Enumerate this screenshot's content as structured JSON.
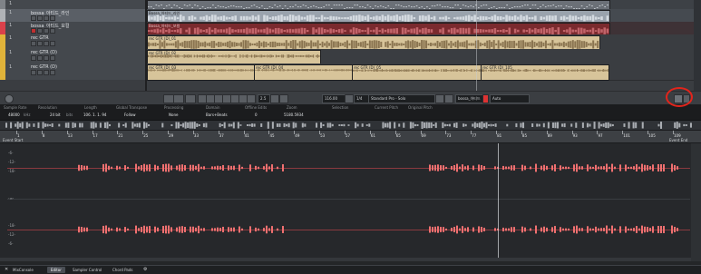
{
  "colors": {
    "accent": "#e3241b",
    "waveform": "#f07070",
    "clip_gold": "#d7c49a",
    "clip_red": "#8a2f2f",
    "clip_gray": "#9aa3ad"
  },
  "tracks": [
    {
      "num": "1",
      "name": "",
      "color": "#7f8388"
    },
    {
      "num": "1",
      "name": "bossa_아티드_라인",
      "color": "#b0b3b7"
    },
    {
      "num": "1",
      "name": "bossa_아티드_보컬",
      "color": "#d9404a"
    },
    {
      "num": "1",
      "name": "rec GTR",
      "color": "#e0b33a"
    },
    {
      "num": "1",
      "name": "rec GTR (D)",
      "color": "#e0b33a"
    },
    {
      "num": "1",
      "name": "rec GTR (D)",
      "color": "#e0b33a"
    }
  ],
  "clips": {
    "bossa_line": "Bossa_아티드_라인",
    "bossa_vocal": "Bossa_아티드_보컬",
    "rec1": "rec GTR (D)_01",
    "rec2": "rec GTR (D)_02",
    "rec3": "rec GTR (D)_03",
    "rec4": "rec GTR (D)_04",
    "rec5": "rec GTR (D)_05",
    "rec6": "rec GTR (D)_105"
  },
  "toolbar": {
    "field_zoom": "2.5",
    "field_pitch": "116.00",
    "field_snap": "1/4",
    "field_algo": "Standard Pro - Solo",
    "field_preset": "bossa_아티드",
    "field_auto": "Auto"
  },
  "info": {
    "headers": [
      "Sample Rate",
      "Resolution",
      "Length",
      "Global Transpose",
      "Processing",
      "Domain",
      "Offline Edits",
      "Zoom",
      "Selection",
      "Current Pitch",
      "Original Pitch"
    ],
    "values": [
      "48000",
      "24 bit",
      "106. 1. 1. 94",
      "Follow",
      "None",
      "Bars+Beats",
      "0",
      "5180.5934",
      "",
      "",
      ""
    ],
    "units": [
      "kHz",
      "bits"
    ]
  },
  "ruler": {
    "labels": [
      "1",
      "8",
      "13",
      "17",
      "21",
      "25",
      "29",
      "33",
      "37",
      "41",
      "45",
      "49",
      "53",
      "57",
      "61",
      "65",
      "69",
      "73",
      "77",
      "81",
      "85",
      "89",
      "93",
      "97",
      "101",
      "105",
      "109"
    ],
    "event_start": "Event Start",
    "event_end": "Event End"
  },
  "amp_labels": [
    "-6-",
    "-12-",
    "-18-",
    "-∞-",
    "-18-",
    "-12-",
    "-6-"
  ],
  "tabs": [
    "MixConsole",
    "Editor",
    "Sampler Control",
    "Chord Pads"
  ]
}
